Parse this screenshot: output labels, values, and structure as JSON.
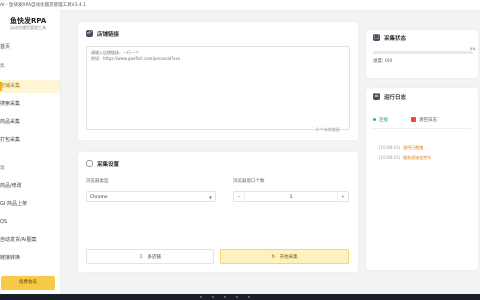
{
  "window": {
    "title": "AI - 鱼快发RPA自动化铺货管理工具V3.4.1"
  },
  "sidebar": {
    "logo": "鱼快发RPA",
    "logo_sub": "自动化铺货管理工具",
    "items": [
      {
        "label": "首页",
        "type": "item"
      },
      {
        "label": "集",
        "type": "header"
      },
      {
        "label": "店铺采集",
        "type": "item",
        "active": true
      },
      {
        "label": "搜索采集",
        "type": "item"
      },
      {
        "label": "商品采集",
        "type": "item"
      },
      {
        "label": "打包采集",
        "type": "item"
      },
      {
        "label": "理",
        "type": "header"
      },
      {
        "label": "商品/修改",
        "type": "item"
      },
      {
        "label": "GI 商品上架",
        "type": "item"
      },
      {
        "label": "QS",
        "type": "item"
      },
      {
        "label": "自动发货/AI图案",
        "type": "item"
      },
      {
        "label": "链接转换",
        "type": "item"
      }
    ],
    "cta": "续费会员"
  },
  "link_card": {
    "title": "店铺链接",
    "textarea_placeholder": "请输入店铺链接，一行一个\n例如：https://www.goofish.com/personal?xxx",
    "counter": "0 个有效链接"
  },
  "settings_card": {
    "title": "采集设置",
    "browser_label": "浏览器类型",
    "browser_value": "Chrome",
    "windows_label": "浏览器窗口个数",
    "windows_value": "1",
    "btn_secondary": "多店铺",
    "btn_primary": "开始采集"
  },
  "status_card": {
    "title": "采集状态",
    "progress": 0,
    "progress_text": "0%",
    "progress_label": "进度: 0/0"
  },
  "log_card": {
    "title": "运行日志",
    "status_pill": "连接",
    "clear_label": "清空日志",
    "logs": [
      {
        "time": "[10:08:41]",
        "msg": "程序已就绪"
      },
      {
        "time": "[10:08:41]",
        "msg": "服务初始化完毕"
      }
    ]
  },
  "colors": {
    "accent": "#f5b400",
    "card_icon": "#4a4f5c",
    "log_orange": "#d97706"
  }
}
